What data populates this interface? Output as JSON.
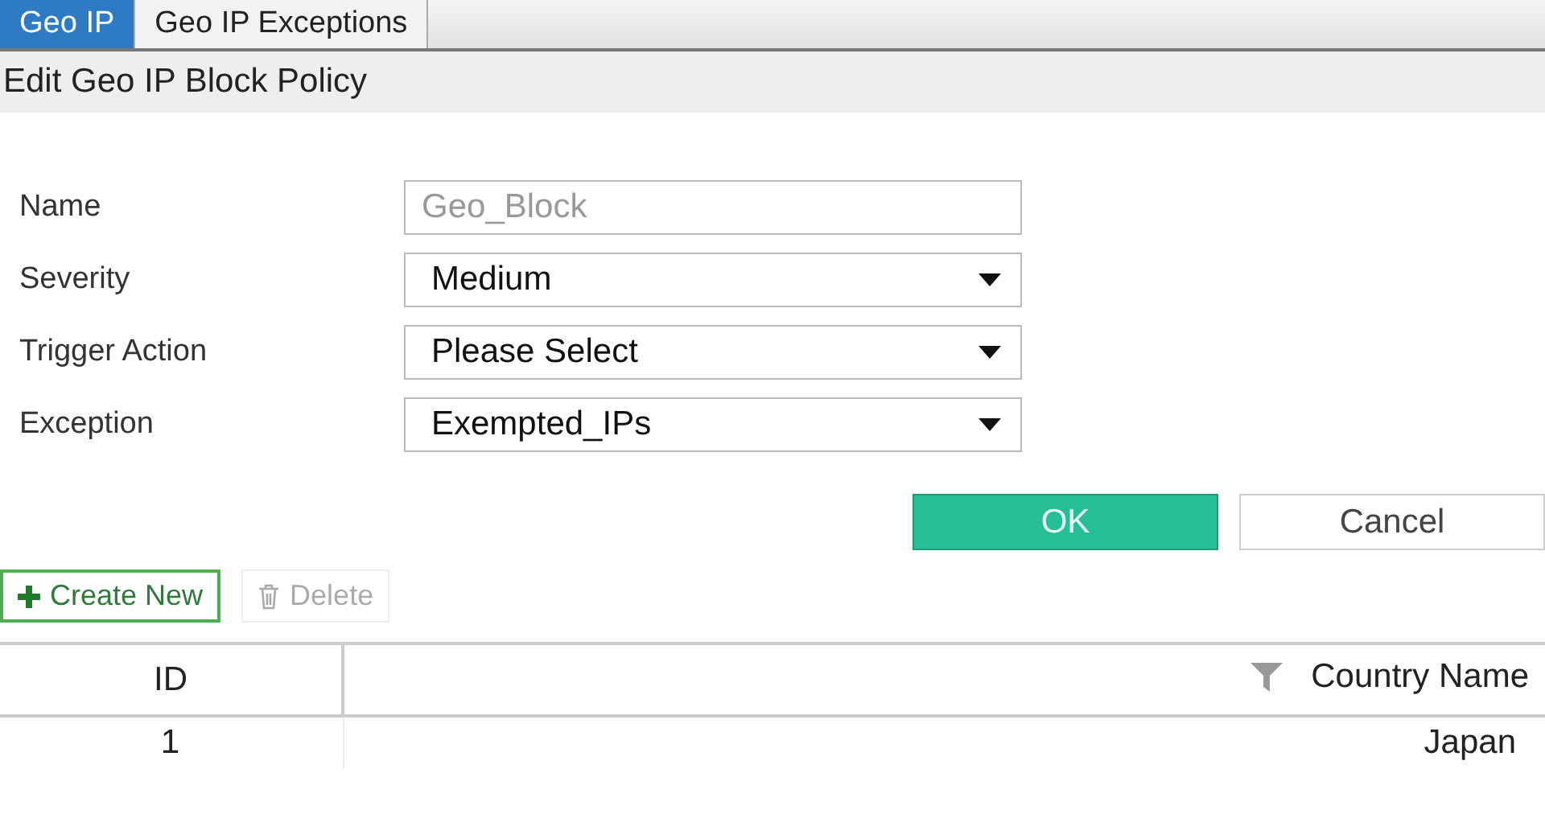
{
  "tabs": [
    {
      "label": "Geo IP",
      "selected": true
    },
    {
      "label": "Geo IP Exceptions",
      "selected": false
    }
  ],
  "dialog": {
    "title": "Edit Geo IP Block Policy",
    "fields": [
      {
        "label": "Name",
        "kind": "text",
        "value": "Geo_Block",
        "disabled": true
      },
      {
        "label": "Severity",
        "kind": "select",
        "value": "Medium",
        "disabled": false
      },
      {
        "label": "Trigger Action",
        "kind": "select",
        "value": "Please Select",
        "disabled": false
      },
      {
        "label": "Exception",
        "kind": "select",
        "value": "Exempted_IPs",
        "disabled": false
      }
    ],
    "buttons": [
      {
        "label": "OK",
        "kind": "primary"
      },
      {
        "label": "Cancel",
        "kind": "secondary"
      }
    ]
  },
  "toolbar": [
    {
      "label": "Create New",
      "kind": "create",
      "disabled": false
    },
    {
      "label": "Delete",
      "kind": "delete",
      "disabled": true
    }
  ],
  "table": {
    "columns": [
      {
        "label": "ID",
        "filter": false
      },
      {
        "label": "Country Name",
        "filter": true
      }
    ],
    "rows": [
      [
        "1",
        "Japan"
      ]
    ]
  }
}
